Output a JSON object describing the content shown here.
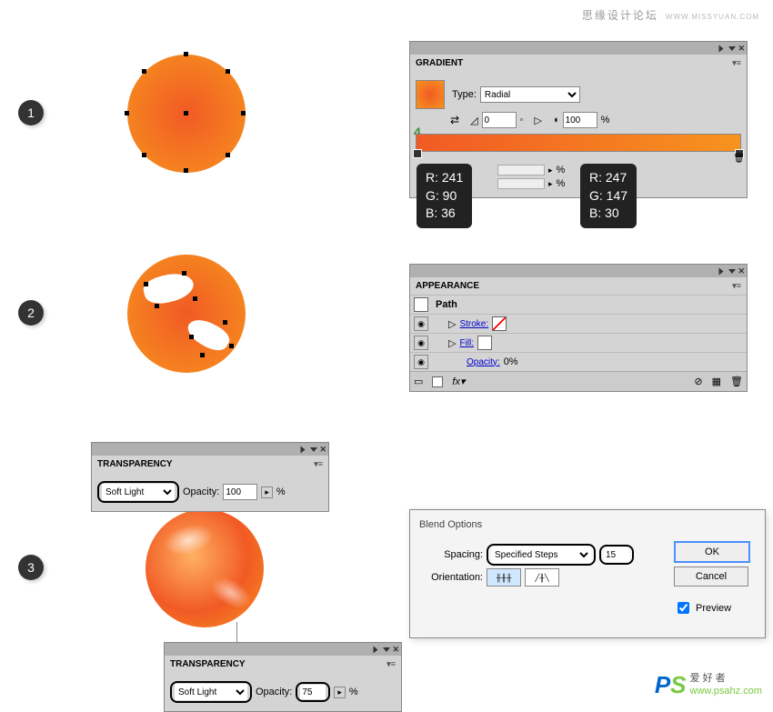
{
  "header": {
    "site": "思缘设计论坛",
    "url": "WWW.MISSYUAN.COM"
  },
  "steps": [
    "1",
    "2",
    "3"
  ],
  "gradient": {
    "title": "GRADIENT",
    "type_label": "Type:",
    "type_value": "Radial",
    "angle": "0",
    "angle_unit": "◦",
    "ratio": "100",
    "ratio_unit": "%",
    "marker": "4",
    "stop1": {
      "r": "R: 241",
      "g": "G: 90",
      "b": "B: 36"
    },
    "stop2": {
      "r": "R: 247",
      "g": "G: 147",
      "b": "B: 30"
    }
  },
  "appearance": {
    "title": "APPEARANCE",
    "path": "Path",
    "stroke": "Stroke:",
    "fill": "Fill:",
    "opacity_label": "Opacity:",
    "opacity_value": "0%"
  },
  "transparency": {
    "title": "TRANSPARENCY",
    "mode": "Soft Light",
    "opacity_label": "Opacity:",
    "top_value": "100",
    "bottom_value": "75",
    "unit": "%"
  },
  "blend": {
    "title": "Blend Options",
    "spacing_label": "Spacing:",
    "spacing_value": "Specified Steps",
    "steps": "15",
    "orientation_label": "Orientation:",
    "ok": "OK",
    "cancel": "Cancel",
    "preview": "Preview"
  },
  "watermark": {
    "cn": "爱 好 者",
    "url": "www.psahz.com"
  }
}
